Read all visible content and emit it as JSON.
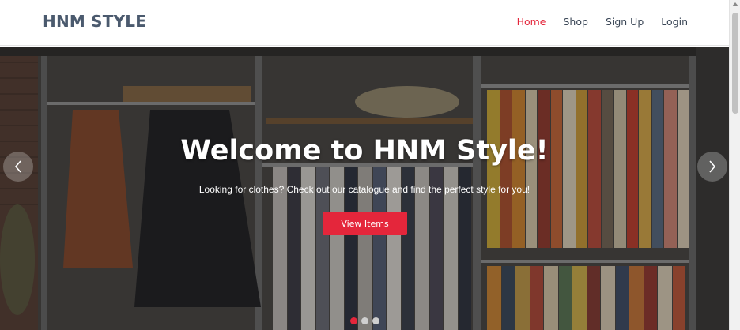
{
  "header": {
    "brand": "HNM STYLE",
    "nav": [
      {
        "label": "Home",
        "active": true
      },
      {
        "label": "Shop",
        "active": false
      },
      {
        "label": "Sign Up",
        "active": false
      },
      {
        "label": "Login",
        "active": false
      }
    ]
  },
  "hero": {
    "title": "Welcome to HNM Style!",
    "subtitle": "Looking for clothes? Check out our catalogue and find the perfect style for you!",
    "button_label": "View Items",
    "slides_count": 3,
    "active_slide": 1
  },
  "colors": {
    "accent": "#e4263b",
    "brand_text": "#4b5a6e",
    "nav_text": "#3a4656"
  },
  "icons": {
    "prev": "chevron-left-icon",
    "next": "chevron-right-icon"
  }
}
